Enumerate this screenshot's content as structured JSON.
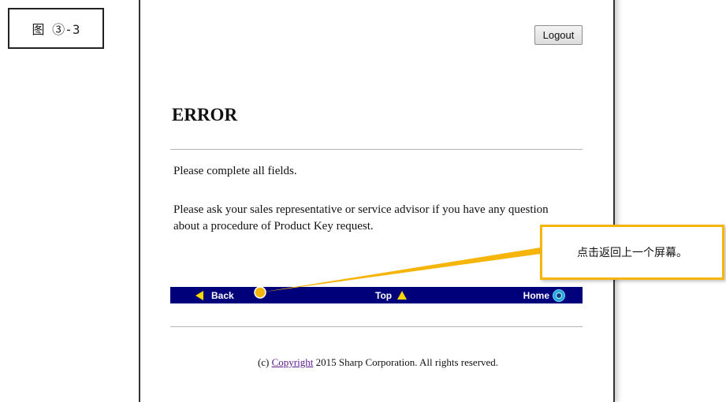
{
  "figure_label": "图 ③-3",
  "header": {
    "logout_label": "Logout"
  },
  "main": {
    "title": "ERROR",
    "message_1": "Please complete all fields.",
    "message_2": "Please ask your sales representative or service advisor if you have any question about a procedure of Product Key request."
  },
  "navbar": {
    "back_label": "Back",
    "top_label": "Top",
    "home_label": "Home",
    "back_icon": "triangle-left-icon",
    "top_icon": "triangle-up-icon",
    "home_icon": "home-circle-icon",
    "background_color": "#00007a",
    "arrow_color": "#ffd800"
  },
  "footer": {
    "prefix": "(c)",
    "link_label": "Copyright",
    "suffix": "2015 Sharp Corporation. All rights reserved."
  },
  "callout": {
    "text": "点击返回上一个屏幕。",
    "color": "#f5b50a"
  }
}
